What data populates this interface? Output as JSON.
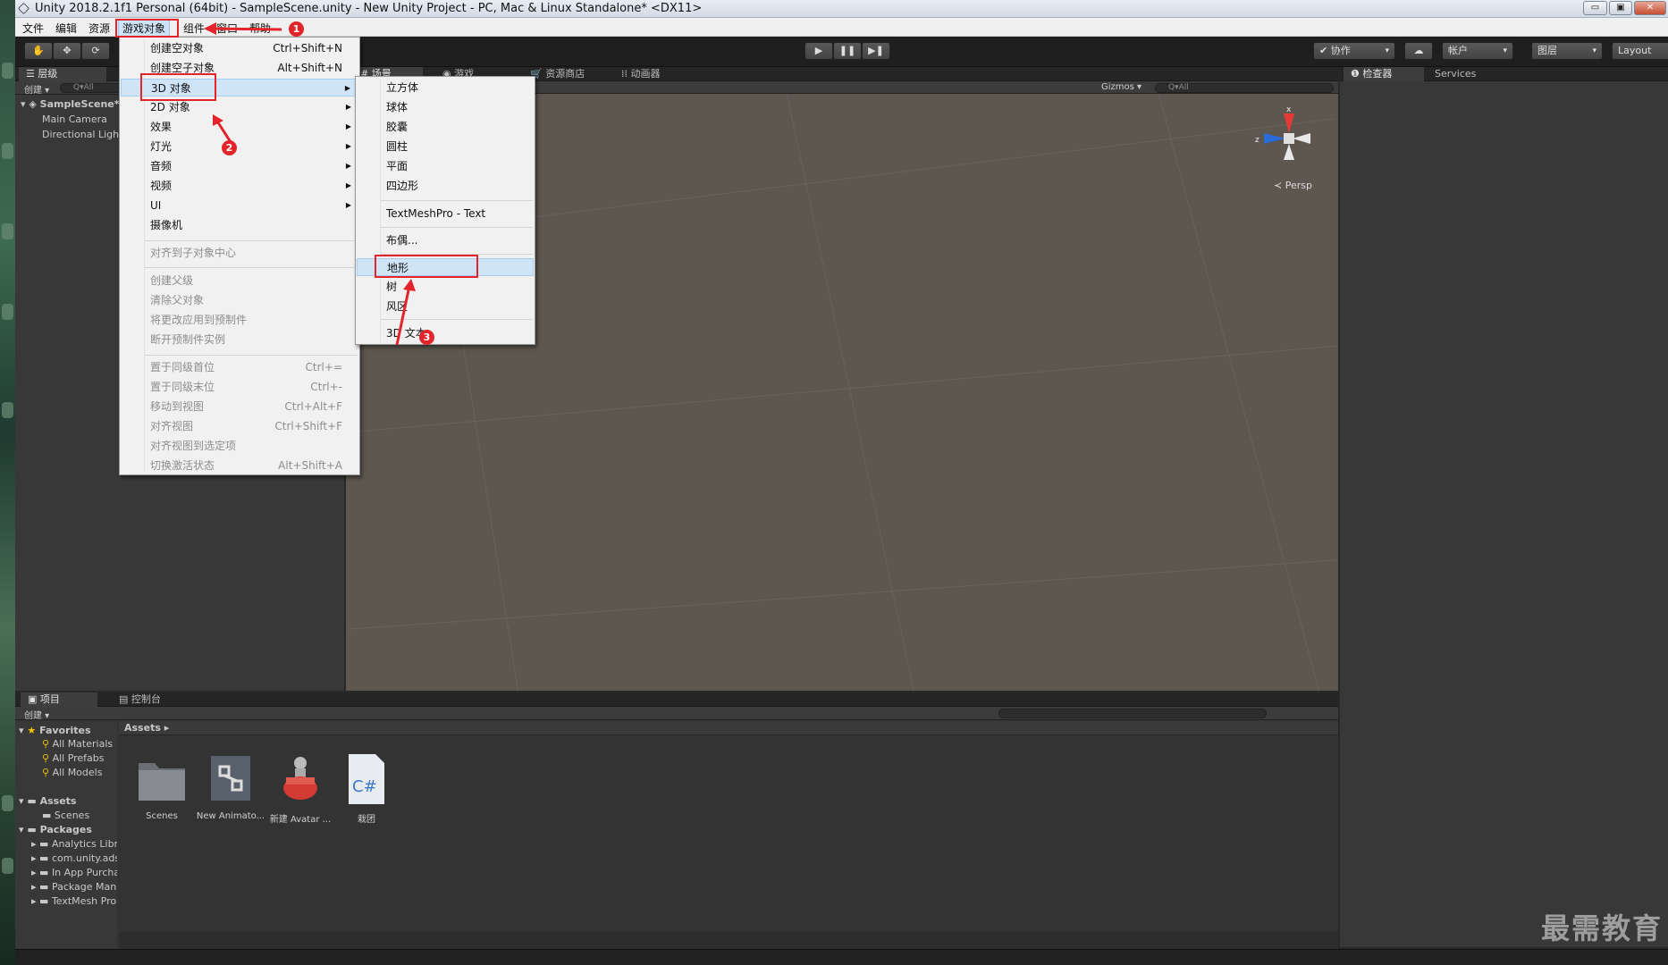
{
  "window": {
    "title": "Unity 2018.2.1f1 Personal (64bit) - SampleScene.unity - New Unity Project - PC, Mac & Linux Standalone* <DX11>",
    "minimize": "▭",
    "maximize": "▣",
    "close": "✕"
  },
  "menubar": [
    "文件",
    "编辑",
    "资源",
    "游戏对象",
    "组件",
    "窗口",
    "帮助"
  ],
  "toolbar": {
    "collab": "✔ 协作",
    "account": "帐户",
    "layers": "图层",
    "layout": "Layout",
    "play": "▶",
    "pause": "❚❚",
    "step": "▶❚"
  },
  "hierarchy": {
    "tab": "☰ 层级",
    "create": "创建 ▾",
    "search": "Q▾All",
    "scene": "SampleScene*",
    "items": [
      "Main Camera",
      "Directional Light"
    ]
  },
  "scene_tabs": [
    "# 场景",
    "◉ 游戏",
    "🛒 资源商店",
    "⁞⁞ 动画器"
  ],
  "scene_toolbar": {
    "gizmos": "Gizmos ▾",
    "search": "Q▾All"
  },
  "gizmo": {
    "x": "x",
    "z": "z",
    "persp": "≺ Persp"
  },
  "inspector": {
    "tab": "❶ 检查器",
    "services": "Services"
  },
  "gameobject_menu": {
    "items": [
      {
        "label": "创建空对象",
        "shortcut": "Ctrl+Shift+N",
        "disabled": false
      },
      {
        "label": "创建空子对象",
        "shortcut": "Alt+Shift+N",
        "disabled": false
      },
      {
        "label": "3D 对象",
        "submenu": true
      },
      {
        "label": "2D 对象",
        "submenu": true
      },
      {
        "label": "效果",
        "submenu": true
      },
      {
        "label": "灯光",
        "submenu": true
      },
      {
        "label": "音频",
        "submenu": true
      },
      {
        "label": "视频",
        "submenu": true
      },
      {
        "label": "UI",
        "submenu": true
      },
      {
        "label": "摄像机"
      },
      {
        "label": "对齐到子对象中心",
        "disabled": true
      },
      {
        "label": "创建父级",
        "disabled": true
      },
      {
        "label": "清除父对象",
        "disabled": true
      },
      {
        "label": "将更改应用到预制件",
        "disabled": true
      },
      {
        "label": "断开预制件实例",
        "disabled": true
      },
      {
        "label": "置于同级首位",
        "shortcut": "Ctrl+=",
        "disabled": true
      },
      {
        "label": "置于同级末位",
        "shortcut": "Ctrl+-",
        "disabled": true
      },
      {
        "label": "移动到视图",
        "shortcut": "Ctrl+Alt+F",
        "disabled": true
      },
      {
        "label": "对齐视图",
        "shortcut": "Ctrl+Shift+F",
        "disabled": true
      },
      {
        "label": "对齐视图到选定项",
        "disabled": true
      },
      {
        "label": "切换激活状态",
        "shortcut": "Alt+Shift+A",
        "disabled": true
      }
    ]
  },
  "object3d_menu": {
    "items": [
      "立方体",
      "球体",
      "胶囊",
      "圆柱",
      "平面",
      "四边形",
      "TextMeshPro - Text",
      "布偶...",
      "地形",
      "树",
      "风区",
      "3D 文本"
    ]
  },
  "annotations": [
    "1",
    "2",
    "3"
  ],
  "project": {
    "tabs": [
      "▣ 项目",
      "▤ 控制台"
    ],
    "create": "创建 ▾",
    "favorites": "Favorites",
    "favorite_items": [
      "All Materials",
      "All Prefabs",
      "All Models"
    ],
    "assets_root": "Assets",
    "assets_children": [
      "Scenes"
    ],
    "packages_root": "Packages",
    "packages": [
      "Analytics Library",
      "com.unity.ads",
      "In App Purchasing",
      "Package Manager UI",
      "TextMesh Pro"
    ],
    "breadcrumb": "Assets ▸",
    "assets": [
      "Scenes",
      "New Animato...",
      "新建 Avatar ...",
      "栽团"
    ]
  },
  "watermark": "最需教育",
  "colors": {
    "annotation": "#e3242b",
    "highlight": "#cfe4f7",
    "scene_bg": "#5d5750"
  }
}
